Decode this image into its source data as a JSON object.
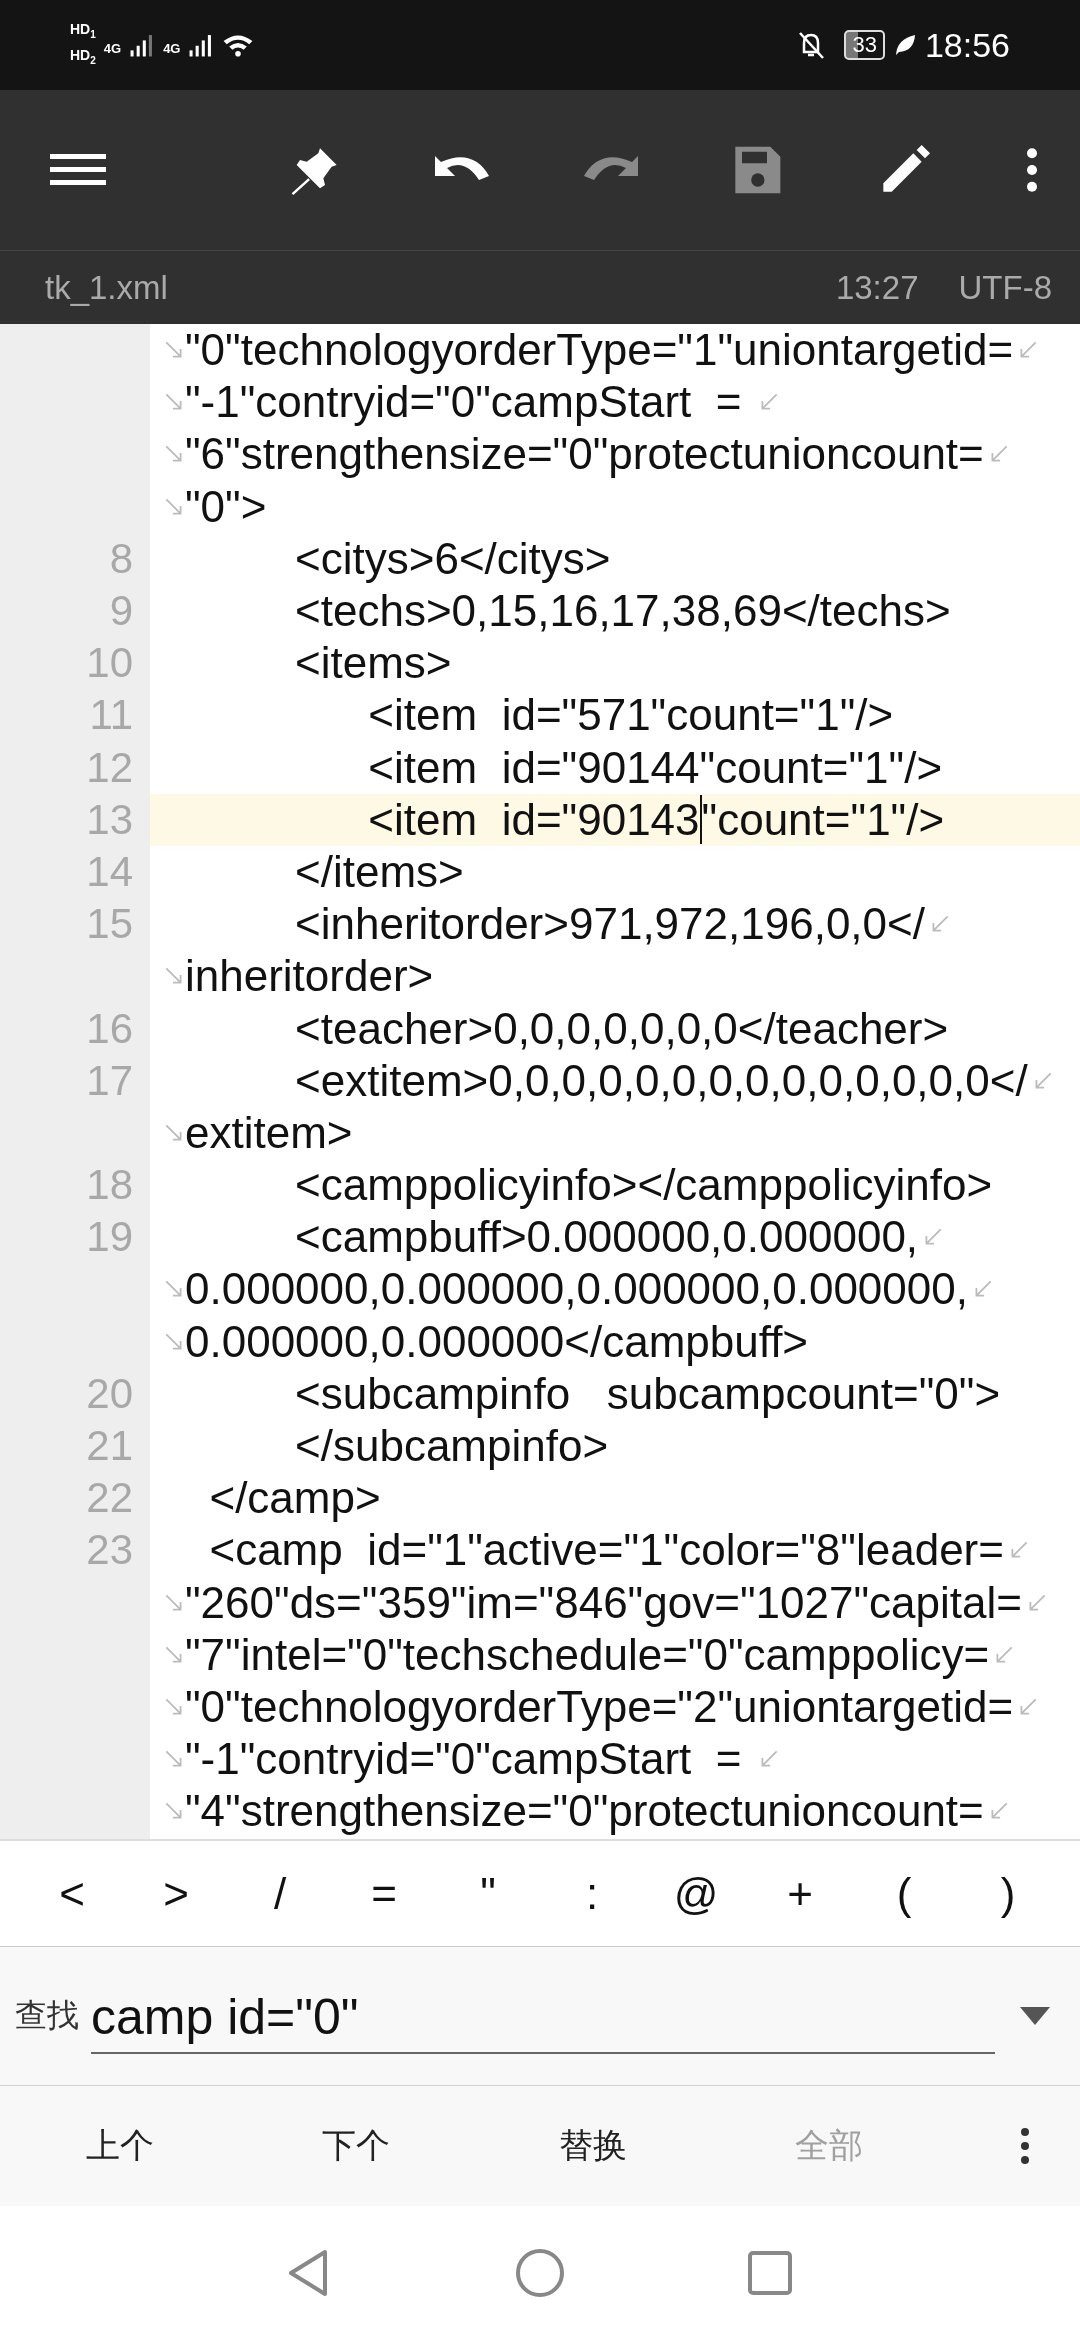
{
  "status_bar": {
    "sims": [
      {
        "hd": "HD",
        "slot": "1",
        "network": "4G"
      },
      {
        "hd": "HD",
        "slot": "2",
        "network": "4G"
      }
    ],
    "battery": "33",
    "time": "18:56"
  },
  "toolbar": [
    {
      "kind": "menu",
      "disabled": false
    },
    {
      "kind": "pin",
      "disabled": false
    },
    {
      "kind": "undo",
      "disabled": false
    },
    {
      "kind": "redo",
      "disabled": true
    },
    {
      "kind": "save",
      "disabled": true
    },
    {
      "kind": "edit",
      "disabled": false
    },
    {
      "kind": "more",
      "disabled": false
    }
  ],
  "file_bar": {
    "filename": "tk_1.xml",
    "position": "13:27",
    "encoding": "UTF-8"
  },
  "editor": {
    "rows": [
      {
        "text": "\"0\"technologyorderType=\"1\"uniontargetid=",
        "continued": true,
        "wraps": true,
        "current": false
      },
      {
        "text": "\"-1\"contryid=\"0\"campStart  = ",
        "continued": true,
        "wraps": true,
        "current": false
      },
      {
        "text": "\"6\"strengthensize=\"0\"protectunioncount=",
        "continued": true,
        "wraps": true,
        "current": false
      },
      {
        "text": "\"0\">",
        "continued": true,
        "wraps": false,
        "current": false
      },
      {
        "number": "8",
        "text": "         <citys>6</citys>",
        "continued": false,
        "wraps": false,
        "current": false
      },
      {
        "number": "9",
        "text": "         <techs>0,15,16,17,38,69</techs>",
        "continued": false,
        "wraps": false,
        "current": false
      },
      {
        "number": "10",
        "text": "         <items>",
        "continued": false,
        "wraps": false,
        "current": false
      },
      {
        "number": "11",
        "text": "               <item  id=\"571\"count=\"1\"/>",
        "continued": false,
        "wraps": false,
        "current": false
      },
      {
        "number": "12",
        "text": "               <item  id=\"90144\"count=\"1\"/>",
        "continued": false,
        "wraps": false,
        "current": false
      },
      {
        "number": "13",
        "text": "               <item  id=\"90143",
        "after_cursor": "\"count=\"1\"/>",
        "continued": false,
        "wraps": false,
        "current": true
      },
      {
        "number": "14",
        "text": "         </items>",
        "continued": false,
        "wraps": false,
        "current": false
      },
      {
        "number": "15",
        "text": "         <inheritorder>971,972,196,0,0</",
        "continued": false,
        "wraps": true,
        "current": false
      },
      {
        "text": "inheritorder>",
        "continued": true,
        "wraps": false,
        "current": false
      },
      {
        "number": "16",
        "text": "         <teacher>0,0,0,0,0,0,0</teacher>",
        "continued": false,
        "wraps": false,
        "current": false
      },
      {
        "number": "17",
        "text": "         <extitem>0,0,0,0,0,0,0,0,0,0,0,0,0,0</",
        "continued": false,
        "wraps": true,
        "current": false
      },
      {
        "text": "extitem>",
        "continued": true,
        "wraps": false,
        "current": false
      },
      {
        "number": "18",
        "text": "         <camppolicyinfo></camppolicyinfo>",
        "continued": false,
        "wraps": false,
        "current": false
      },
      {
        "number": "19",
        "text": "         <campbuff>0.000000,0.000000,",
        "continued": false,
        "wraps": true,
        "current": false
      },
      {
        "text": "0.000000,0.000000,0.000000,0.000000,",
        "continued": true,
        "wraps": true,
        "current": false
      },
      {
        "text": "0.000000,0.000000</campbuff>",
        "continued": true,
        "wraps": false,
        "current": false
      },
      {
        "number": "20",
        "text": "         <subcampinfo   subcampcount=\"0\">",
        "continued": false,
        "wraps": false,
        "current": false
      },
      {
        "number": "21",
        "text": "         </subcampinfo>",
        "continued": false,
        "wraps": false,
        "current": false
      },
      {
        "number": "22",
        "text": "  </camp>",
        "continued": false,
        "wraps": false,
        "current": false
      },
      {
        "number": "23",
        "text": "  <camp  id=\"1\"active=\"1\"color=\"8\"leader=",
        "continued": false,
        "wraps": true,
        "current": false
      },
      {
        "text": "\"260\"ds=\"359\"im=\"846\"gov=\"1027\"capital=",
        "continued": true,
        "wraps": true,
        "current": false
      },
      {
        "text": "\"7\"intel=\"0\"techschedule=\"0\"camppolicy=",
        "continued": true,
        "wraps": true,
        "current": false
      },
      {
        "text": "\"0\"technologyorderType=\"2\"uniontargetid=",
        "continued": true,
        "wraps": true,
        "current": false
      },
      {
        "text": "\"-1\"contryid=\"0\"campStart  = ",
        "continued": true,
        "wraps": true,
        "current": false
      },
      {
        "text": "\"4\"strengthensize=\"0\"protectunioncount=",
        "continued": true,
        "wraps": true,
        "current": false
      }
    ]
  },
  "symbol_keys": [
    "<",
    ">",
    "/",
    "=",
    "\"",
    ":",
    "@",
    "+",
    "(",
    ")"
  ],
  "find_bar": {
    "label": "查找",
    "value": "camp id=\"0\""
  },
  "find_actions": [
    {
      "kind": "text",
      "label": "上个",
      "disabled": false
    },
    {
      "kind": "text",
      "label": "下个",
      "disabled": false
    },
    {
      "kind": "text",
      "label": "替换",
      "disabled": false
    },
    {
      "kind": "text",
      "label": "全部",
      "disabled": true
    },
    {
      "kind": "more",
      "disabled": false
    }
  ],
  "nav_bar": [
    {
      "kind": "back"
    },
    {
      "kind": "home"
    },
    {
      "kind": "recents"
    }
  ]
}
